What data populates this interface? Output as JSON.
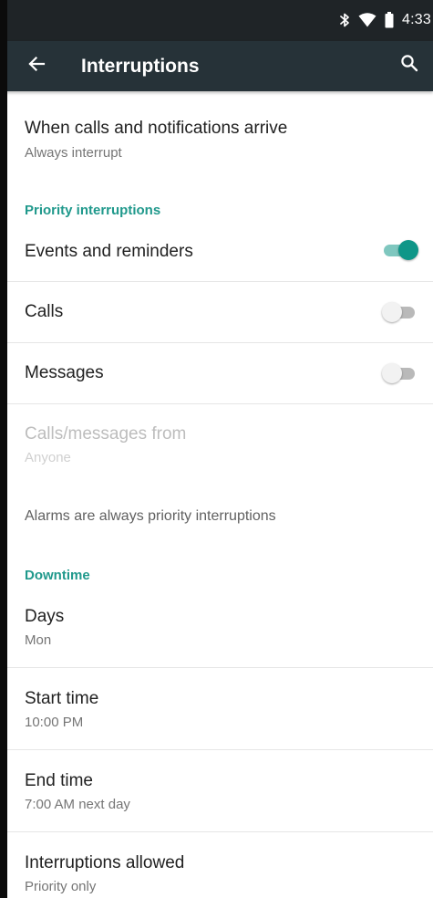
{
  "status_bar": {
    "time": "4:33",
    "icons": [
      "bluetooth-icon",
      "wifi-icon",
      "battery-icon"
    ]
  },
  "app_bar": {
    "title": "Interruptions",
    "back_icon": "arrow-back-icon",
    "search_icon": "search-icon"
  },
  "when_arrive": {
    "title": "When calls and notifications arrive",
    "summary": "Always interrupt"
  },
  "priority": {
    "header": "Priority interruptions",
    "events": {
      "title": "Events and reminders",
      "enabled": true
    },
    "calls": {
      "title": "Calls",
      "enabled": false
    },
    "messages": {
      "title": "Messages",
      "enabled": false
    },
    "from": {
      "title": "Calls/messages from",
      "summary": "Anyone"
    },
    "alarms_note": "Alarms are always priority interruptions"
  },
  "downtime": {
    "header": "Downtime",
    "days": {
      "title": "Days",
      "summary": "Mon"
    },
    "start": {
      "title": "Start time",
      "summary": "10:00 PM"
    },
    "end": {
      "title": "End time",
      "summary": "7:00 AM next day"
    },
    "allowed": {
      "title": "Interruptions allowed",
      "summary": "Priority only"
    }
  },
  "colors": {
    "accent": "#20998c",
    "switch_on_thumb": "#0f9688",
    "switch_on_track": "#7fc7bf",
    "toolbar": "#263238",
    "status_bar": "#1f2427"
  }
}
